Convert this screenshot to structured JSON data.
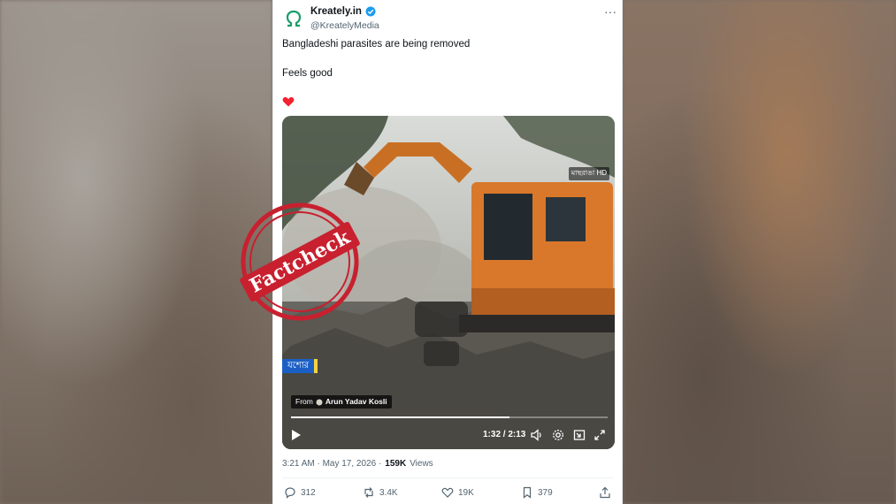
{
  "account": {
    "display_name": "Kreately.in",
    "handle": "@KreatelyMedia",
    "verified": true,
    "avatar_icon": "omega-logo-icon",
    "avatar_color": "#1a9c6b"
  },
  "tweet": {
    "text_line_1": "Bangladeshi parasites are being removed",
    "text_line_2": "Feels good",
    "emoji": "red-heart"
  },
  "video": {
    "channel_logo_text": "মাছরাঙা HD",
    "location_tag": "যশোর",
    "source_prefix": "From",
    "source_name": "Arun Yadav Kosli",
    "time_display": "1:32 / 2:13",
    "progress": 0.69
  },
  "overlay": {
    "stamp_text": "Factcheck",
    "stamp_color": "#c8202f"
  },
  "meta": {
    "timestamp": "3:21 AM · May 17, 2026 ·",
    "views_count": "159K",
    "views_label": "Views"
  },
  "actions": {
    "replies": "312",
    "reposts": "3.4K",
    "likes": "19K",
    "bookmarks": "379"
  }
}
